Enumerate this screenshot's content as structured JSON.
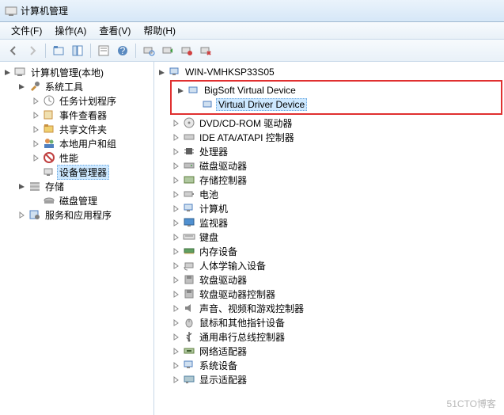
{
  "window": {
    "title": "计算机管理"
  },
  "menu": {
    "file": "文件(F)",
    "action": "操作(A)",
    "view": "查看(V)",
    "help": "帮助(H)"
  },
  "lefttree": {
    "root": "计算机管理(本地)",
    "systools": "系统工具",
    "scheduler": "任务计划程序",
    "eventviewer": "事件查看器",
    "sharedfolders": "共享文件夹",
    "localusers": "本地用户和组",
    "performance": "性能",
    "devmgr": "设备管理器",
    "storage": "存储",
    "diskmgmt": "磁盘管理",
    "services": "服务和应用程序"
  },
  "righttree": {
    "host": "WIN-VMHKSP33S05",
    "bigsoft": "BigSoft Virtual Device",
    "vdd": "Virtual Driver Device",
    "dvd": "DVD/CD-ROM 驱动器",
    "ide": "IDE ATA/ATAPI 控制器",
    "cpu": "处理器",
    "disk": "磁盘驱动器",
    "storagectrl": "存储控制器",
    "battery": "电池",
    "computer": "计算机",
    "monitor": "监视器",
    "keyboard": "键盘",
    "memory": "内存设备",
    "hid": "人体学输入设备",
    "floppy": "软盘驱动器",
    "floppyctrl": "软盘驱动器控制器",
    "sound": "声音、视频和游戏控制器",
    "mouse": "鼠标和其他指针设备",
    "usb": "通用串行总线控制器",
    "netadapter": "网络适配器",
    "sysdev": "系统设备",
    "display": "显示适配器"
  },
  "watermark": "51CTO博客"
}
